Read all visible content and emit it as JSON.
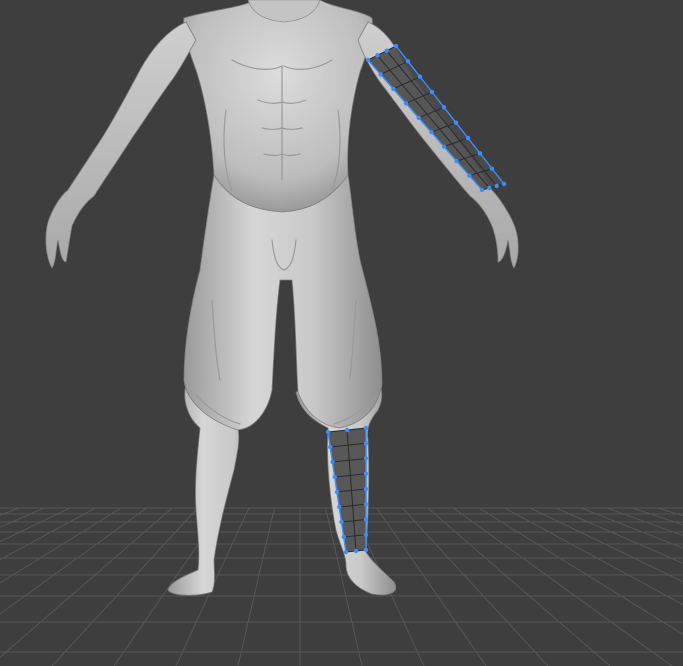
{
  "viewport": {
    "background_color": "#3e3e3e",
    "grid_color": "#575757",
    "mesh_color": "#c8c8c8",
    "mesh_shadow_color": "#8a8a8a",
    "topology_fill_color": "#4a4a4a",
    "topology_line_color": "#2a2a2a",
    "topology_vertex_color": "#3a8eff",
    "model": "human-base-mesh",
    "topology_strips": [
      "left-forearm",
      "right-lower-leg"
    ]
  }
}
